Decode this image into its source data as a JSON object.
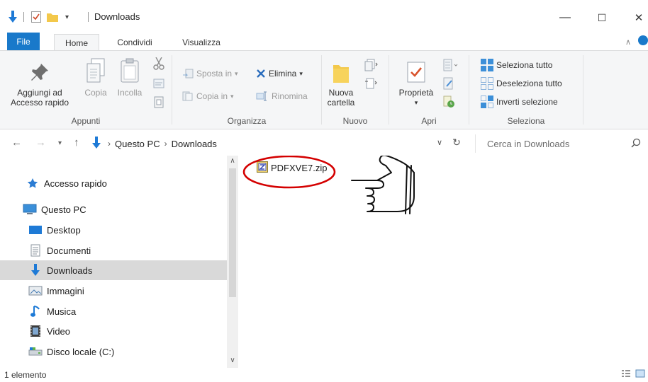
{
  "window": {
    "title": "Downloads",
    "minimize_glyph": "—",
    "maximize_glyph": "☐",
    "close_glyph": "✕"
  },
  "tabs": {
    "file": "File",
    "home": "Home",
    "share": "Condividi",
    "view": "Visualizza"
  },
  "ribbon": {
    "appunti": {
      "label": "Appunti",
      "pin_label_1": "Aggiungi ad",
      "pin_label_2": "Accesso rapido",
      "copy": "Copia",
      "paste": "Incolla"
    },
    "organizza": {
      "label": "Organizza",
      "move_to": "Sposta in",
      "copy_to": "Copia in",
      "delete": "Elimina",
      "rename": "Rinomina"
    },
    "nuovo": {
      "label": "Nuovo",
      "new_folder_1": "Nuova",
      "new_folder_2": "cartella"
    },
    "apri": {
      "label": "Apri",
      "properties": "Proprietà"
    },
    "seleziona": {
      "label": "Seleziona",
      "select_all": "Seleziona tutto",
      "select_none": "Deseleziona tutto",
      "invert": "Inverti selezione"
    }
  },
  "address": {
    "crumbs": [
      "Questo PC",
      "Downloads"
    ],
    "search_placeholder": "Cerca in Downloads"
  },
  "nav": {
    "quick_access": "Accesso rapido",
    "this_pc": "Questo PC",
    "items": [
      "Desktop",
      "Documenti",
      "Downloads",
      "Immagini",
      "Musica",
      "Video",
      "Disco locale (C:)"
    ]
  },
  "content": {
    "files": [
      "PDFXVE7.zip"
    ]
  },
  "status": {
    "count": "1 elemento"
  },
  "colors": {
    "accent": "#1979ca",
    "annotation": "#d40000",
    "selection": "#d9d9d9"
  }
}
